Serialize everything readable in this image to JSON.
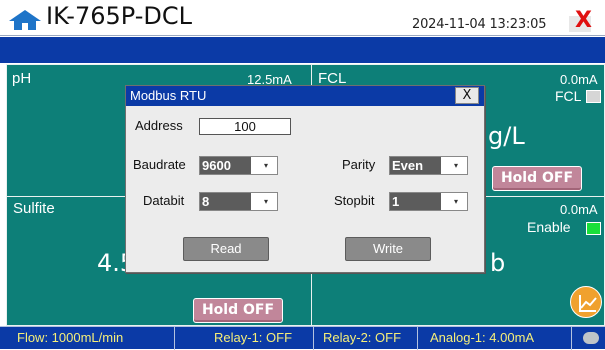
{
  "header": {
    "device_name": "IK-765P-DCL",
    "datetime": "2024-11-04 13:23:05",
    "close_label": "X"
  },
  "panels": {
    "ph": {
      "label": "pH",
      "current": "12.5mA",
      "value_partial": ""
    },
    "fcl": {
      "label": "FCL",
      "current": "0.0mA",
      "checkbox_label": "FCL",
      "unit_partial": "g/L",
      "hold_label": "Hold OFF"
    },
    "sulfite": {
      "label": "Sulfite",
      "value_partial": "4.5",
      "hold_label": "Hold OFF"
    },
    "right_lower": {
      "current": "0.0mA",
      "checkbox_label": "Enable",
      "unit_partial": "b"
    }
  },
  "modal": {
    "title": "Modbus RTU",
    "close_label": "X",
    "address_label": "Address",
    "address_value": "100",
    "baudrate_label": "Baudrate",
    "baudrate_value": "9600",
    "parity_label": "Parity",
    "parity_value": "Even",
    "databit_label": "Databit",
    "databit_value": "8",
    "stopbit_label": "Stopbit",
    "stopbit_value": "1",
    "read_label": "Read",
    "write_label": "Write"
  },
  "status": {
    "flow": "Flow: 1000mL/min",
    "relay1": "Relay-1: OFF",
    "relay2": "Relay-2: OFF",
    "analog1": "Analog-1: 4.00mA"
  },
  "colors": {
    "panel": "#0d7f78",
    "band": "#0b3aa6",
    "hold_button": "#c1869a",
    "enable_on": "#19e03a",
    "close_red": "#e01010"
  }
}
